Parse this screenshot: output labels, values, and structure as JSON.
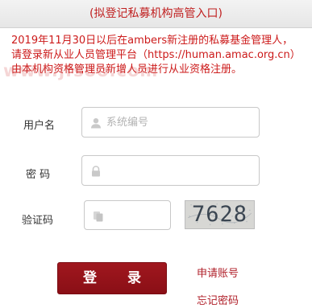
{
  "header": {
    "title": "(拟登记私募机构高管入口)"
  },
  "notice": {
    "text": "2019年11月30日以后在ambers新注册的私募基金管理人，请登录新从业人员管理平台（https://human.amac.org.cn）由本机构资格管理员新增人员进行从业资格注册。",
    "watermark": "www.jfsoo.com"
  },
  "form": {
    "username_label": "用户名",
    "username_placeholder": "系统编号",
    "username_icon": "user-icon",
    "password_label": "密 码",
    "password_icon": "lock-icon",
    "captcha_label": "验证码",
    "captcha_icon": "copy-icon",
    "captcha_code": "7628"
  },
  "actions": {
    "login_label": "登 录",
    "register_link": "申请账号",
    "forgot_link": "忘记密码"
  },
  "colors": {
    "accent": "#cc1a1a",
    "button": "#9a141b"
  }
}
